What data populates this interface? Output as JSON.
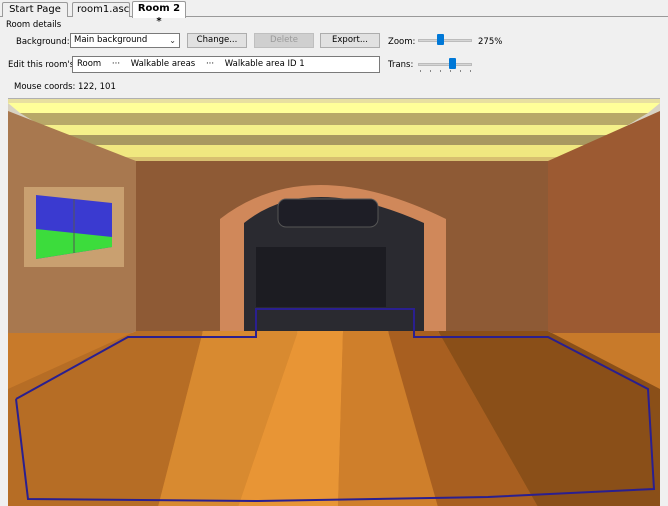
{
  "tabs": [
    {
      "label": "Start Page"
    },
    {
      "label": "room1.asc"
    },
    {
      "label": "Room 2 *"
    }
  ],
  "room_details": {
    "group_title": "Room details",
    "background_label": "Background:",
    "background_value": "Main background",
    "change_button": "Change...",
    "delete_button": "Delete",
    "export_button": "Export...",
    "zoom_label": "Zoom:",
    "zoom_value": "275%",
    "zoom_fraction": 0.4,
    "edit_label": "Edit this room's:",
    "path": [
      "Room",
      "···",
      "Walkable areas",
      "···",
      "Walkable area ID 1"
    ],
    "trans_label": "Trans:",
    "trans_fraction": 0.65,
    "mouse_label": "Mouse coords:",
    "mouse_value": "122, 101"
  },
  "colors": {
    "accent": "#0078d7",
    "walkable_outline": "#2a1f8f"
  }
}
